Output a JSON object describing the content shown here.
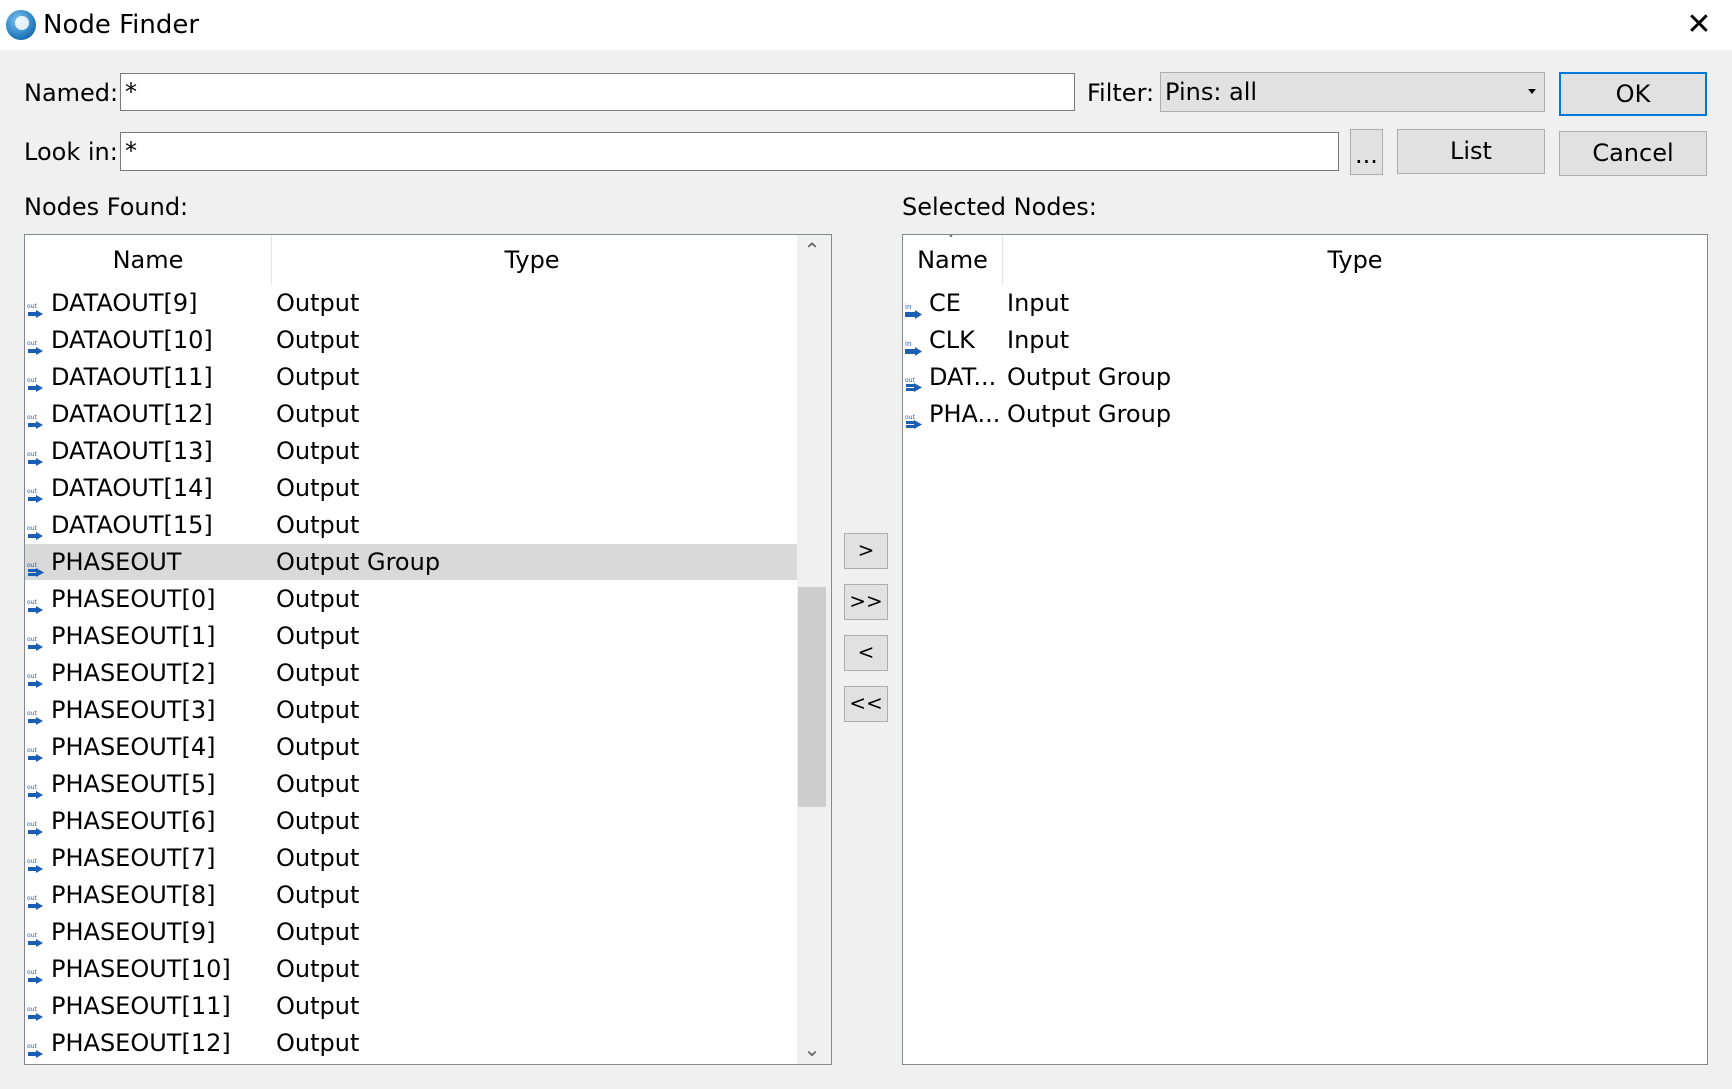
{
  "window": {
    "title": "Node Finder",
    "close_glyph": "✕"
  },
  "form": {
    "named_label": "Named:",
    "named_value": "*",
    "filter_label": "Filter:",
    "filter_value": "Pins: all",
    "look_in_label": "Look in:",
    "look_in_value": "*",
    "browse_label": "...",
    "ok_label": "OK",
    "list_label": "List",
    "cancel_label": "Cancel"
  },
  "nodes_found": {
    "label": "Nodes Found:",
    "columns": [
      "Name",
      "Type"
    ],
    "rows": [
      {
        "name": "DATAOUT[9]",
        "type": "Output",
        "icon": "output-pin-icon"
      },
      {
        "name": "DATAOUT[10]",
        "type": "Output",
        "icon": "output-pin-icon"
      },
      {
        "name": "DATAOUT[11]",
        "type": "Output",
        "icon": "output-pin-icon"
      },
      {
        "name": "DATAOUT[12]",
        "type": "Output",
        "icon": "output-pin-icon"
      },
      {
        "name": "DATAOUT[13]",
        "type": "Output",
        "icon": "output-pin-icon"
      },
      {
        "name": "DATAOUT[14]",
        "type": "Output",
        "icon": "output-pin-icon"
      },
      {
        "name": "DATAOUT[15]",
        "type": "Output",
        "icon": "output-pin-icon"
      },
      {
        "name": "PHASEOUT",
        "type": "Output Group",
        "icon": "output-group-icon",
        "selected": true
      },
      {
        "name": "PHASEOUT[0]",
        "type": "Output",
        "icon": "output-pin-icon"
      },
      {
        "name": "PHASEOUT[1]",
        "type": "Output",
        "icon": "output-pin-icon"
      },
      {
        "name": "PHASEOUT[2]",
        "type": "Output",
        "icon": "output-pin-icon"
      },
      {
        "name": "PHASEOUT[3]",
        "type": "Output",
        "icon": "output-pin-icon"
      },
      {
        "name": "PHASEOUT[4]",
        "type": "Output",
        "icon": "output-pin-icon"
      },
      {
        "name": "PHASEOUT[5]",
        "type": "Output",
        "icon": "output-pin-icon"
      },
      {
        "name": "PHASEOUT[6]",
        "type": "Output",
        "icon": "output-pin-icon"
      },
      {
        "name": "PHASEOUT[7]",
        "type": "Output",
        "icon": "output-pin-icon"
      },
      {
        "name": "PHASEOUT[8]",
        "type": "Output",
        "icon": "output-pin-icon"
      },
      {
        "name": "PHASEOUT[9]",
        "type": "Output",
        "icon": "output-pin-icon"
      },
      {
        "name": "PHASEOUT[10]",
        "type": "Output",
        "icon": "output-pin-icon"
      },
      {
        "name": "PHASEOUT[11]",
        "type": "Output",
        "icon": "output-pin-icon"
      },
      {
        "name": "PHASEOUT[12]",
        "type": "Output",
        "icon": "output-pin-icon"
      }
    ]
  },
  "transfer_buttons": [
    ">",
    ">>",
    "<",
    "<<"
  ],
  "selected_nodes": {
    "label": "Selected Nodes:",
    "columns": [
      "Name",
      "Type"
    ],
    "sort_indicator": "˅",
    "rows": [
      {
        "name": "CE",
        "type": "Input",
        "icon": "input-pin-icon"
      },
      {
        "name": "CLK",
        "type": "Input",
        "icon": "input-pin-icon"
      },
      {
        "name": "DAT...",
        "type": "Output Group",
        "icon": "output-group-icon"
      },
      {
        "name": "PHA...",
        "type": "Output Group",
        "icon": "output-group-icon"
      }
    ]
  },
  "colors": {
    "accent": "#0078d7",
    "pin_blue": "#1a5fb4",
    "selection": "#d9d9d9"
  }
}
